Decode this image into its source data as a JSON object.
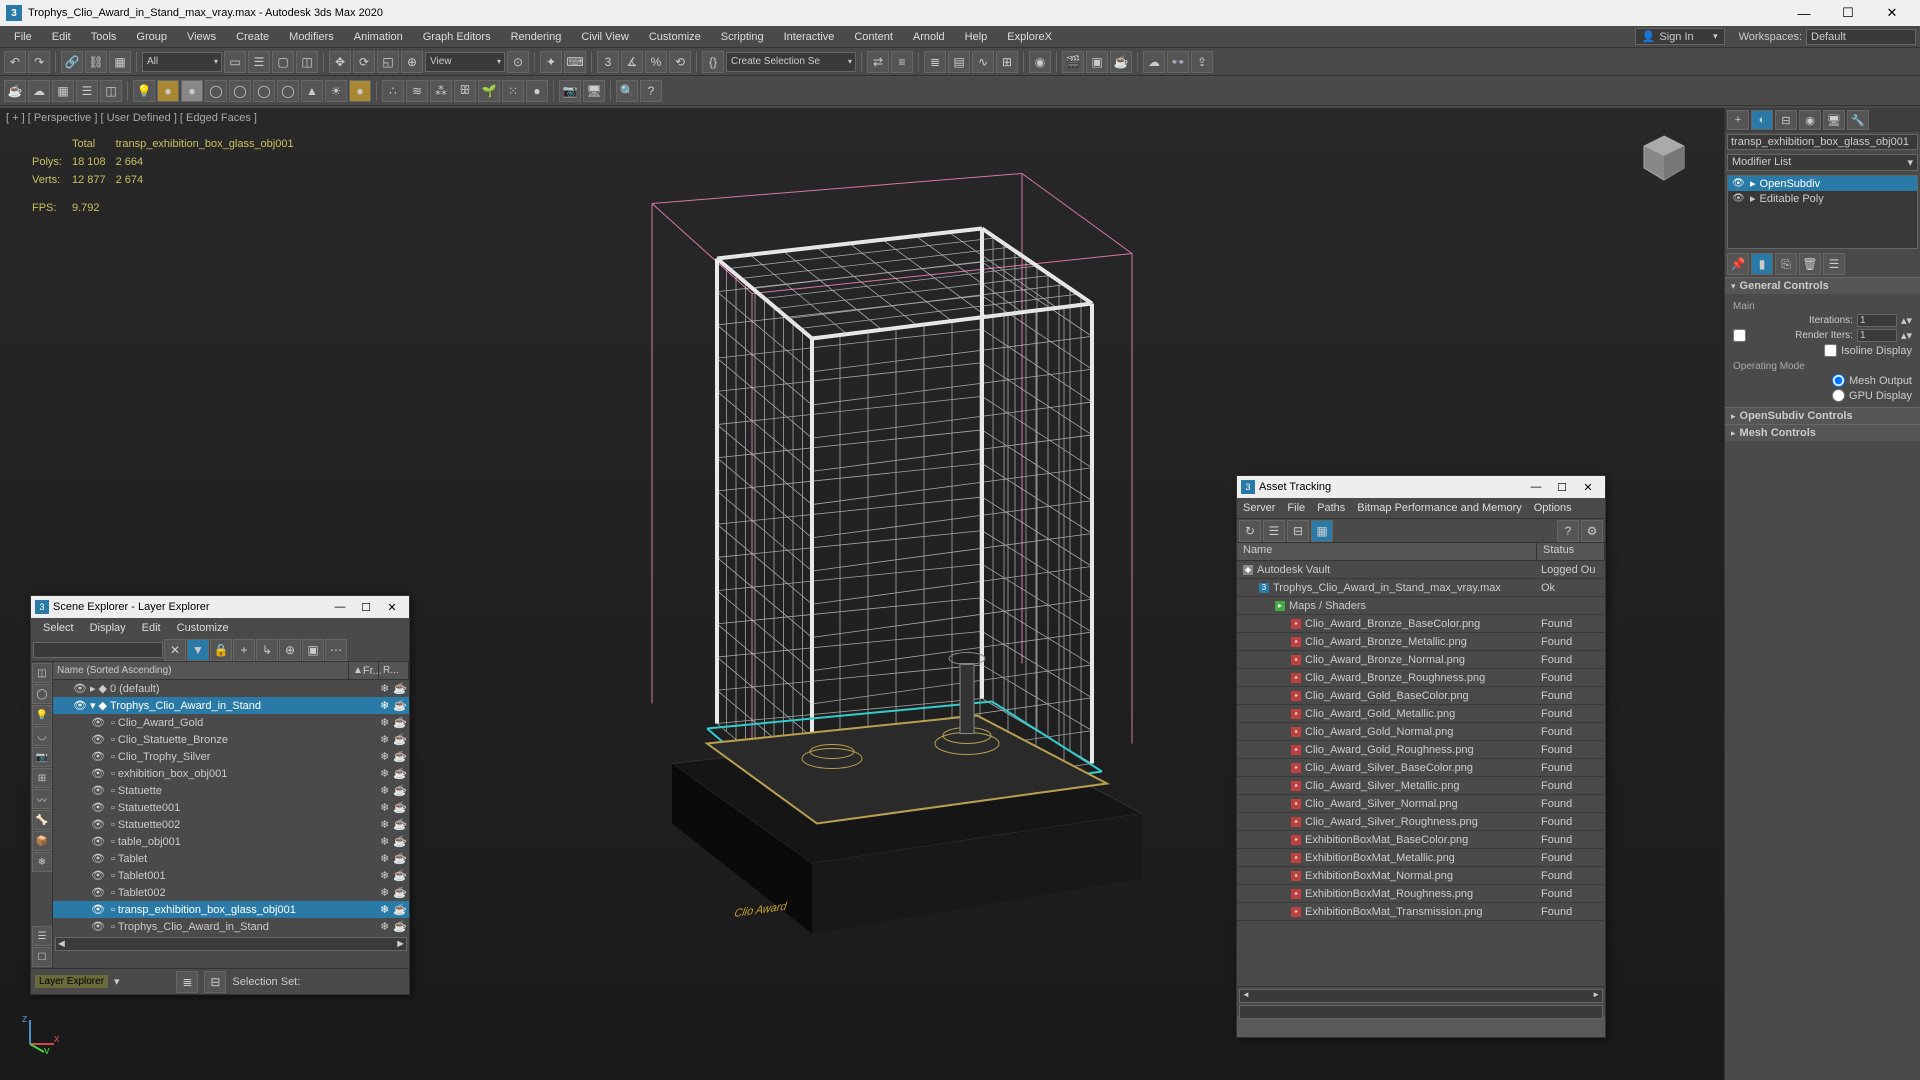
{
  "titlebar": {
    "title": "Trophys_Clio_Award_in_Stand_max_vray.max - Autodesk 3ds Max 2020"
  },
  "menubar": {
    "items": [
      "File",
      "Edit",
      "Tools",
      "Group",
      "Views",
      "Create",
      "Modifiers",
      "Animation",
      "Graph Editors",
      "Rendering",
      "Civil View",
      "Customize",
      "Scripting",
      "Interactive",
      "Content",
      "Arnold",
      "Help",
      "ExploreX"
    ],
    "signin": "Sign In",
    "workspaces_label": "Workspaces:",
    "workspace": "Default"
  },
  "toolbar1": {
    "dropdown_all": "All",
    "dropdown_view": "View",
    "selset": "Create Selection Se"
  },
  "viewport": {
    "label": "[ + ] [ Perspective ] [ User Defined ] [ Edged Faces ]",
    "stats": {
      "obj_name": "transp_exhibition_box_glass_obj001",
      "headers": [
        "",
        "Total",
        ""
      ],
      "polys_label": "Polys:",
      "polys_total": "18 108",
      "polys_sel": "2 664",
      "verts_label": "Verts:",
      "verts_total": "12 877",
      "verts_sel": "2 674",
      "fps_label": "FPS:",
      "fps": "9.792"
    },
    "pedestal_text": "Clio Award"
  },
  "right_panel": {
    "object_name": "transp_exhibition_box_glass_obj001",
    "modlist_label": "Modifier List",
    "stack": [
      {
        "name": "OpenSubdiv",
        "selected": true
      },
      {
        "name": "Editable Poly",
        "selected": false
      }
    ],
    "rollouts": {
      "general": {
        "title": "General Controls",
        "main_label": "Main",
        "iterations_label": "Iterations:",
        "iterations": "1",
        "render_iters_label": "Render Iters:",
        "render_iters": "1",
        "isoline_label": "Isoline Display",
        "opmode_label": "Operating Mode",
        "mesh_output": "Mesh Output",
        "gpu_display": "GPU Display"
      },
      "opensubdiv": {
        "title": "OpenSubdiv Controls"
      },
      "mesh": {
        "title": "Mesh Controls"
      }
    }
  },
  "scene_explorer": {
    "title": "Scene Explorer - Layer Explorer",
    "menus": [
      "Select",
      "Display",
      "Edit",
      "Customize"
    ],
    "col_name": "Name (Sorted Ascending)",
    "col_fr": "Fr...",
    "col_r": "R...",
    "tree": [
      {
        "depth": 0,
        "name": "0 (default)",
        "expander": "▸",
        "sel": false,
        "layer": true
      },
      {
        "depth": 0,
        "name": "Trophys_Clio_Award_in_Stand",
        "expander": "▾",
        "sel": true,
        "layer": true
      },
      {
        "depth": 1,
        "name": "Clio_Award_Gold",
        "sel": false
      },
      {
        "depth": 1,
        "name": "Clio_Statuette_Bronze",
        "sel": false
      },
      {
        "depth": 1,
        "name": "Clio_Trophy_Silver",
        "sel": false
      },
      {
        "depth": 1,
        "name": "exhibition_box_obj001",
        "sel": false
      },
      {
        "depth": 1,
        "name": "Statuette",
        "sel": false
      },
      {
        "depth": 1,
        "name": "Statuette001",
        "sel": false
      },
      {
        "depth": 1,
        "name": "Statuette002",
        "sel": false
      },
      {
        "depth": 1,
        "name": "table_obj001",
        "sel": false
      },
      {
        "depth": 1,
        "name": "Tablet",
        "sel": false
      },
      {
        "depth": 1,
        "name": "Tablet001",
        "sel": false
      },
      {
        "depth": 1,
        "name": "Tablet002",
        "sel": false
      },
      {
        "depth": 1,
        "name": "transp_exhibition_box_glass_obj001",
        "sel": true
      },
      {
        "depth": 1,
        "name": "Trophys_Clio_Award_in_Stand",
        "sel": false
      }
    ],
    "footer_label": "Layer Explorer",
    "selset_label": "Selection Set:"
  },
  "asset_tracking": {
    "title": "Asset Tracking",
    "menus": [
      "Server",
      "File",
      "Paths",
      "Bitmap Performance and Memory",
      "Options"
    ],
    "col_name": "Name",
    "col_status": "Status",
    "rows": [
      {
        "indent": 0,
        "icon": "vault",
        "name": "Autodesk Vault",
        "status": "Logged Ou"
      },
      {
        "indent": 1,
        "icon": "max",
        "name": "Trophys_Clio_Award_in_Stand_max_vray.max",
        "status": "Ok"
      },
      {
        "indent": 2,
        "icon": "group",
        "name": "Maps / Shaders",
        "status": ""
      },
      {
        "indent": 3,
        "icon": "png",
        "name": "Clio_Award_Bronze_BaseColor.png",
        "status": "Found"
      },
      {
        "indent": 3,
        "icon": "png",
        "name": "Clio_Award_Bronze_Metallic.png",
        "status": "Found"
      },
      {
        "indent": 3,
        "icon": "png",
        "name": "Clio_Award_Bronze_Normal.png",
        "status": "Found"
      },
      {
        "indent": 3,
        "icon": "png",
        "name": "Clio_Award_Bronze_Roughness.png",
        "status": "Found"
      },
      {
        "indent": 3,
        "icon": "png",
        "name": "Clio_Award_Gold_BaseColor.png",
        "status": "Found"
      },
      {
        "indent": 3,
        "icon": "png",
        "name": "Clio_Award_Gold_Metallic.png",
        "status": "Found"
      },
      {
        "indent": 3,
        "icon": "png",
        "name": "Clio_Award_Gold_Normal.png",
        "status": "Found"
      },
      {
        "indent": 3,
        "icon": "png",
        "name": "Clio_Award_Gold_Roughness.png",
        "status": "Found"
      },
      {
        "indent": 3,
        "icon": "png",
        "name": "Clio_Award_Silver_BaseColor.png",
        "status": "Found"
      },
      {
        "indent": 3,
        "icon": "png",
        "name": "Clio_Award_Silver_Metallic.png",
        "status": "Found"
      },
      {
        "indent": 3,
        "icon": "png",
        "name": "Clio_Award_Silver_Normal.png",
        "status": "Found"
      },
      {
        "indent": 3,
        "icon": "png",
        "name": "Clio_Award_Silver_Roughness.png",
        "status": "Found"
      },
      {
        "indent": 3,
        "icon": "png",
        "name": "ExhibitionBoxMat_BaseColor.png",
        "status": "Found"
      },
      {
        "indent": 3,
        "icon": "png",
        "name": "ExhibitionBoxMat_Metallic.png",
        "status": "Found"
      },
      {
        "indent": 3,
        "icon": "png",
        "name": "ExhibitionBoxMat_Normal.png",
        "status": "Found"
      },
      {
        "indent": 3,
        "icon": "png",
        "name": "ExhibitionBoxMat_Roughness.png",
        "status": "Found"
      },
      {
        "indent": 3,
        "icon": "png",
        "name": "ExhibitionBoxMat_Transmission.png",
        "status": "Found"
      }
    ]
  }
}
